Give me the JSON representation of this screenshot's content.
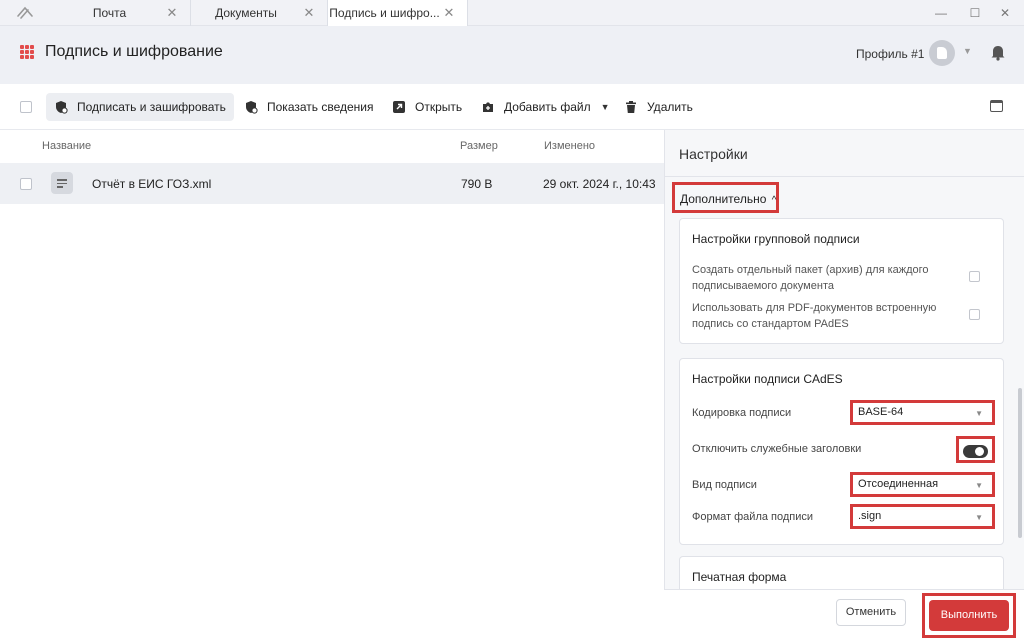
{
  "tabs": [
    {
      "label": "Почта"
    },
    {
      "label": "Документы"
    },
    {
      "label": "Подпись и шифро..."
    }
  ],
  "tab_close_glyph": "✕",
  "window_controls": {
    "minimize": "—",
    "maximize": "☐",
    "close": "✕"
  },
  "header": {
    "title": "Подпись и шифрование",
    "profile": "Профиль #1"
  },
  "toolbar": {
    "sign_encrypt": "Подписать и зашифровать",
    "show_info": "Показать сведения",
    "open": "Открыть",
    "add_file": "Добавить файл",
    "delete": "Удалить"
  },
  "file_list": {
    "columns": {
      "name": "Название",
      "size": "Размер",
      "modified": "Изменено"
    },
    "rows": [
      {
        "name": "Отчёт в ЕИС ГОЗ.xml",
        "size": "790 B",
        "modified": "29 окт. 2024 г., 10:43"
      }
    ]
  },
  "settings": {
    "title": "Настройки",
    "advanced": "Дополнительно",
    "group_card": {
      "title": "Настройки групповой подписи",
      "options": [
        {
          "label": "Создать отдельный пакет (архив) для каждого подписываемого документа",
          "checked": false
        },
        {
          "label": "Использовать для PDF-документов встроенную подпись со стандартом PAdES",
          "checked": false
        }
      ]
    },
    "cades_card": {
      "title": "Настройки подписи CAdES",
      "encoding_label": "Кодировка подписи",
      "encoding_value": "BASE-64",
      "headers_label": "Отключить служебные заголовки",
      "headers_on": true,
      "type_label": "Вид подписи",
      "type_value": "Отсоединенная",
      "format_label": "Формат файла подписи",
      "format_value": ".sign"
    },
    "print_card": {
      "title": "Печатная форма"
    },
    "cancel": "Отменить",
    "submit": "Выполнить"
  },
  "colors": {
    "accent": "#d33a3a",
    "header_bg": "#eef0f5"
  }
}
